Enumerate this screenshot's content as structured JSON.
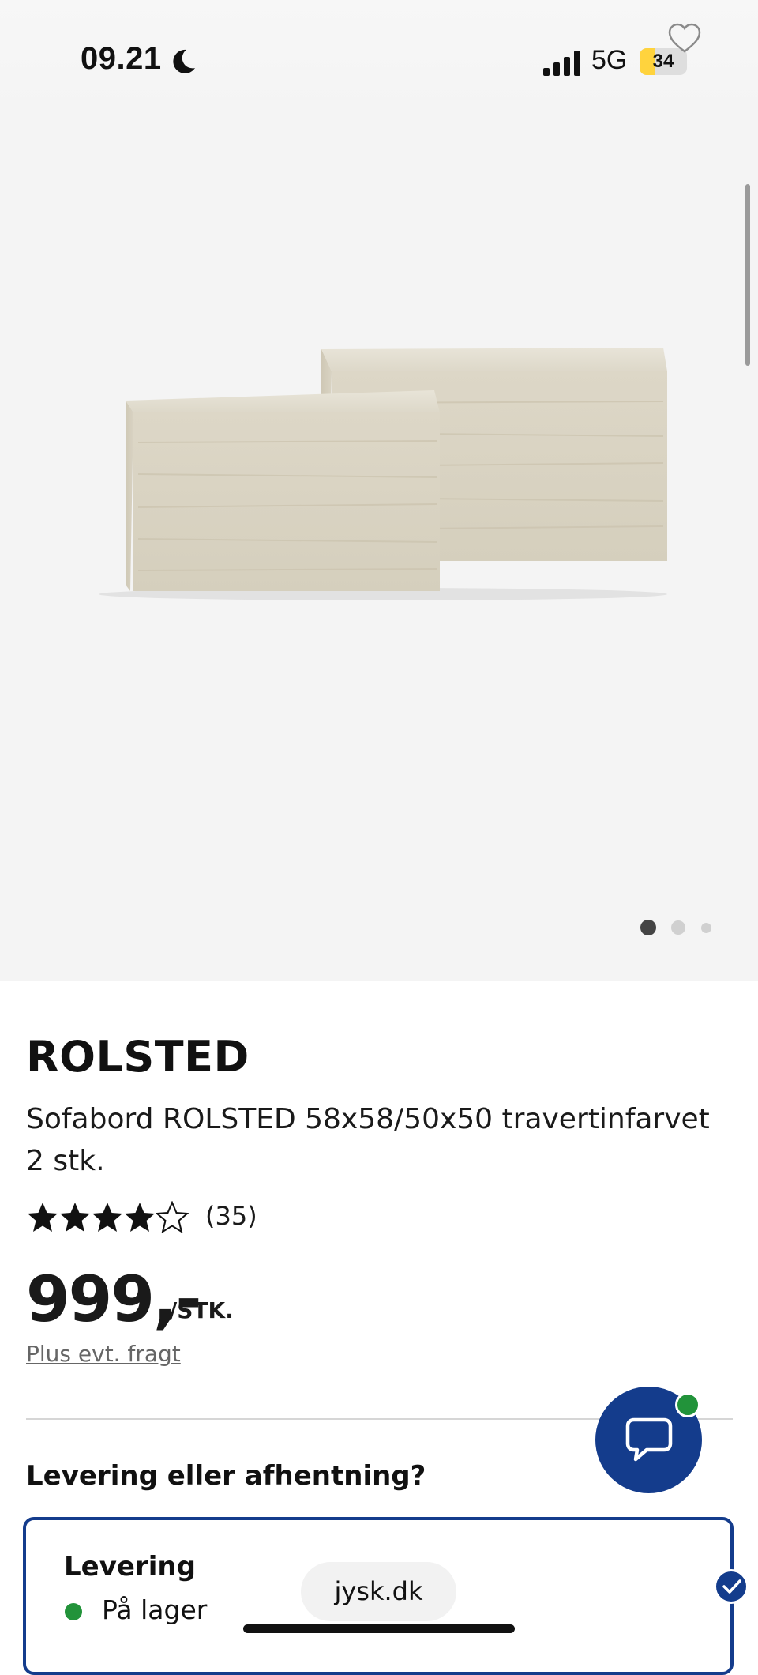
{
  "status_bar": {
    "time": "09.21",
    "network": "5G",
    "battery_level": "34",
    "battery_percent": 34,
    "battery_color": "#ffd33d"
  },
  "product": {
    "brand": "ROLSTED",
    "description": "Sofabord ROLSTED 58x58/50x50 travertinfarvet 2 stk.",
    "rating_stars": 4,
    "rating_max": 5,
    "review_count": "(35)",
    "price": "999,-",
    "price_unit": "/STK.",
    "freight_note": "Plus evt. fragt",
    "image_index": 1,
    "image_count": 3
  },
  "delivery": {
    "question": "Levering eller afhentning?",
    "option_title": "Levering",
    "stock_status": "På lager",
    "stock_color": "#22933a"
  },
  "browser": {
    "url": "jysk.dk"
  },
  "colors": {
    "brand_blue": "#143c8c",
    "online_green": "#22933a"
  }
}
